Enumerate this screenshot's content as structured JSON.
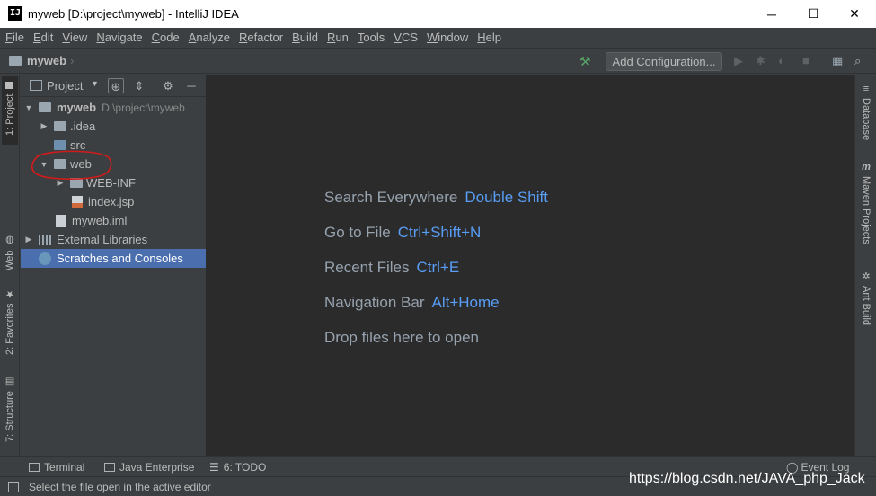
{
  "window": {
    "title": "myweb [D:\\project\\myweb] - IntelliJ IDEA",
    "app_icon_text": "IJ",
    "minimize_glyph": "─",
    "maximize_glyph": "☐",
    "close_glyph": "✕"
  },
  "menu": [
    "File",
    "Edit",
    "View",
    "Navigate",
    "Code",
    "Analyze",
    "Refactor",
    "Build",
    "Run",
    "Tools",
    "VCS",
    "Window",
    "Help"
  ],
  "navbar": {
    "breadcrumb": "myweb",
    "add_configuration_label": "Add Configuration..."
  },
  "left_tabs": {
    "project": "1: Project",
    "web": "Web",
    "favorites": "2: Favorites",
    "structure": "7: Structure"
  },
  "project_panel": {
    "title": "Project"
  },
  "tree": [
    {
      "name": "myweb",
      "path": "D:\\project\\myweb",
      "bold": true
    },
    {
      "name": ".idea"
    },
    {
      "name": "src"
    },
    {
      "name": "web"
    },
    {
      "name": "WEB-INF"
    },
    {
      "name": "index.jsp"
    },
    {
      "name": "myweb.iml"
    },
    {
      "name": "External Libraries"
    },
    {
      "name": "Scratches and Consoles",
      "selected": true
    }
  ],
  "editor_hints": [
    {
      "label": "Search Everywhere",
      "key": "Double Shift"
    },
    {
      "label": "Go to File",
      "key": "Ctrl+Shift+N"
    },
    {
      "label": "Recent Files",
      "key": "Ctrl+E"
    },
    {
      "label": "Navigation Bar",
      "key": "Alt+Home"
    },
    {
      "label": "Drop files here to open",
      "key": ""
    }
  ],
  "right_tabs": {
    "database": "Database",
    "maven": "Maven Projects",
    "ant": "Ant Build"
  },
  "bottom_tabs": {
    "terminal": "Terminal",
    "java_enterprise": "Java Enterprise",
    "todo": "6: TODO",
    "event_log": "Event Log"
  },
  "status": {
    "message": "Select the file open in the active editor"
  },
  "watermark": "https://blog.csdn.net/JAVA_php_Jack",
  "colors": {
    "editor_bg": "#2b2b2b",
    "panel_bg": "#3c3f41",
    "selection": "#4b6eaf",
    "shortcut_blue": "#589df6",
    "annotation_red": "#d11b1b"
  }
}
